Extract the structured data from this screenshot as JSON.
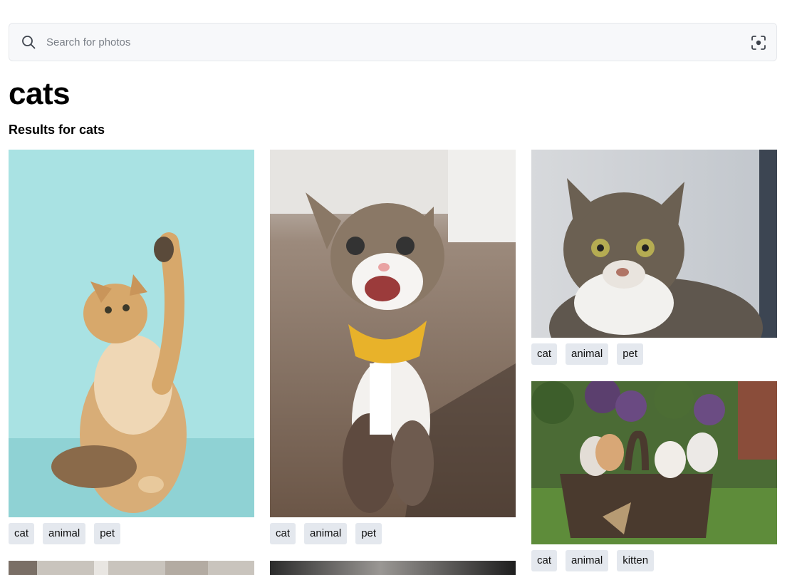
{
  "search": {
    "placeholder": "Search for photos"
  },
  "page": {
    "title": "cats",
    "results_heading": "Results for cats"
  },
  "icons": {
    "search": "search-icon",
    "visual_search": "visual-search-icon"
  },
  "colors": {
    "search_bg": "#f7f8fa",
    "tag_bg": "#e4e8ee"
  },
  "photos": [
    {
      "tags": [
        "cat",
        "animal",
        "pet"
      ]
    },
    {
      "tags": [
        "cat",
        "animal",
        "pet"
      ]
    },
    {
      "tags": [
        "cat",
        "animal",
        "pet"
      ]
    },
    {
      "tags": [
        "cat",
        "animal",
        "kitten"
      ]
    }
  ]
}
